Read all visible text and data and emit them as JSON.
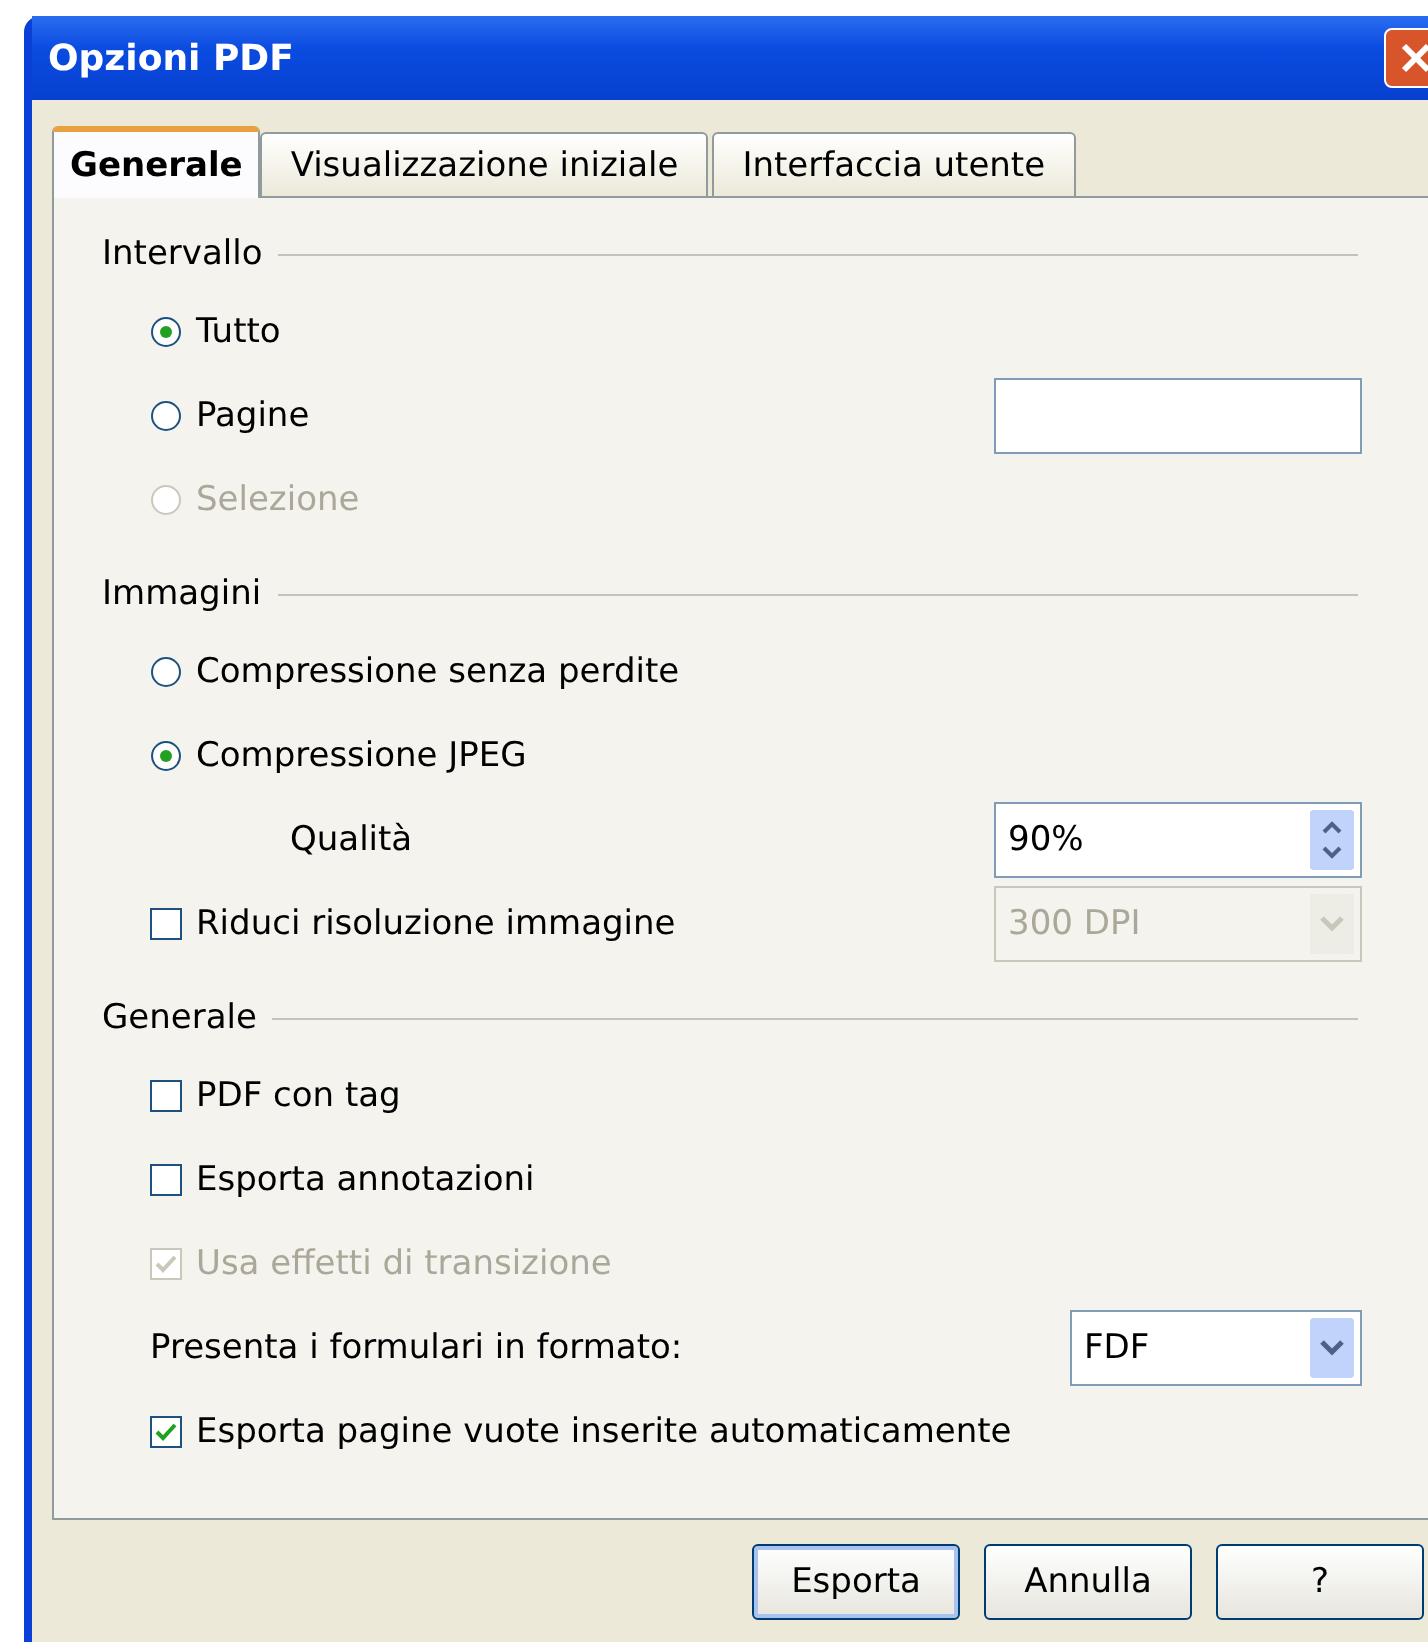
{
  "window": {
    "title": "Opzioni PDF"
  },
  "tabs": [
    {
      "label": "Generale",
      "selected": true
    },
    {
      "label": "Visualizzazione iniziale",
      "selected": false
    },
    {
      "label": "Interfaccia utente",
      "selected": false
    }
  ],
  "sections": [
    {
      "title": "Intervallo",
      "items": [
        {
          "kind": "radio",
          "label": "Tutto",
          "selected": true,
          "disabled": false
        },
        {
          "kind": "radio-field",
          "label": "Pagine",
          "selected": false,
          "disabled": false
        },
        {
          "kind": "radio",
          "label": "Selezione",
          "selected": false,
          "disabled": true
        }
      ]
    },
    {
      "title": "Immagini",
      "items": [
        {
          "kind": "radio",
          "label": "Compressione senza perdite",
          "selected": false,
          "disabled": false
        },
        {
          "kind": "radio",
          "label": "Compressione JPEG",
          "selected": true,
          "disabled": false
        },
        {
          "kind": "spin",
          "label": "Qualità",
          "value": "90%"
        },
        {
          "kind": "checkbox-combo",
          "label": "Riduci risoluzione immagine",
          "checked": false,
          "disabled": false,
          "combo": {
            "value": "300 DPI",
            "disabled": true
          }
        }
      ]
    },
    {
      "title": "Generale",
      "items": [
        {
          "kind": "checkbox",
          "label": "PDF con tag",
          "checked": false,
          "disabled": false
        },
        {
          "kind": "checkbox",
          "label": "Esporta annotazioni",
          "checked": false,
          "disabled": false
        },
        {
          "kind": "checkbox",
          "label": "Usa effetti di transizione",
          "checked": true,
          "disabled": true
        },
        {
          "kind": "combo",
          "label": "Presenta i formulari in formato:",
          "value": "FDF",
          "disabled": false
        },
        {
          "kind": "checkbox",
          "label": "Esporta pagine vuote inserite automaticamente",
          "checked": true,
          "disabled": false
        }
      ]
    }
  ],
  "buttons": [
    {
      "label": "Esporta",
      "default": true
    },
    {
      "label": "Annulla",
      "default": false
    },
    {
      "label": "?",
      "default": false
    }
  ]
}
